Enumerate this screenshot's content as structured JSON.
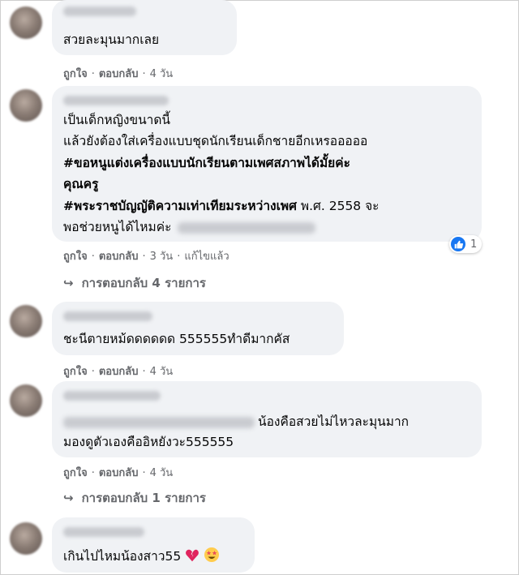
{
  "comments": [
    {
      "lines": [
        "สวยละมุนมากเลย"
      ],
      "actions": {
        "like": "ถูกใจ",
        "reply": "ตอบกลับ",
        "time": "4 วัน"
      }
    },
    {
      "lines": [
        "เป็นเด็กหญิงขนาดนี้",
        "แล้วยังต้องใส่เครื่องแบบชุดนักเรียนเด็กชายอีกเหรอออออ",
        "#ขอหนูแต่งเครื่องแบบนักเรียนตามเพศสภาพได้มั้ยค่ะ",
        "คุณครู",
        "#พระราชบัญญัติความเท่าเทียมระหว่างเพศ",
        " พ.ศ. 2558 จะ",
        "พอช่วยหนูได้ไหมค่ะ"
      ],
      "reaction": {
        "icon": "like-icon",
        "count": "1"
      },
      "actions": {
        "like": "ถูกใจ",
        "reply": "ตอบกลับ",
        "time": "3 วัน",
        "edited": "แก้ไขแล้ว"
      },
      "replies": "การตอบกลับ 4 รายการ"
    },
    {
      "lines": [
        "ชะนีตายหม้ดดดดดด 555555ทำดีมากคัส"
      ],
      "actions": {
        "like": "ถูกใจ",
        "reply": "ตอบกลับ",
        "time": "4 วัน"
      }
    },
    {
      "lines": [
        "น้องคือสวยไม่ไหวละมุนมาก",
        "มองดูตัวเองคืออิหยังวะ555555"
      ],
      "actions": {
        "like": "ถูกใจ",
        "reply": "ตอบกลับ",
        "time": "4 วัน"
      },
      "replies": "การตอบกลับ 1 รายการ"
    },
    {
      "lines": [
        "เกินไปไหมน้องสาว55"
      ],
      "emojis": [
        "broken-heart-emoji",
        "star-struck-emoji"
      ]
    }
  ],
  "colors": {
    "bubble": "#f0f2f5",
    "meta": "#65676b",
    "like": "#1877f2"
  }
}
